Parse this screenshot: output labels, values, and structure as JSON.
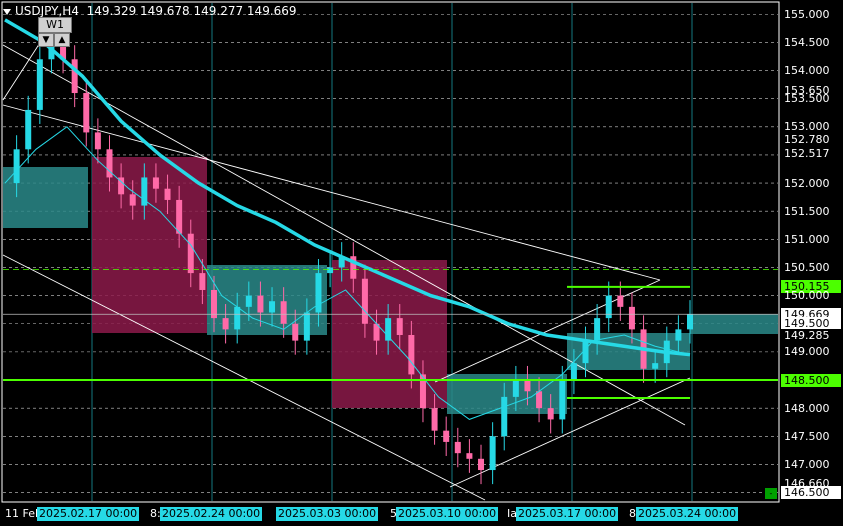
{
  "header": {
    "symbol": "USDJPY,H4",
    "ohlc": "149.329 149.678 149.277 149.669",
    "period_button": "W1"
  },
  "colors": {
    "background": "#000000",
    "grid": "#ffffff",
    "ma_slow": "#26d9e6",
    "ma_fast": "#26d9e6",
    "bull_candle": "#26d9e6",
    "bear_candle": "#ff6aa8",
    "zone_teal": "#2a8a8a",
    "zone_maroon": "#8c1a4a",
    "level_green": "#4cff00",
    "channel": "#ffffff"
  },
  "price_scale": {
    "ticks": [
      "155.000",
      "154.500",
      "154.000",
      "153.650",
      "153.500",
      "153.000",
      "152.780",
      "152.517",
      "152.000",
      "151.500",
      "151.000",
      "150.500",
      "150.155",
      "150.000",
      "149.669",
      "149.500",
      "149.285",
      "149.000",
      "148.500",
      "148.000",
      "147.500",
      "147.000",
      "146.660",
      "146.500"
    ]
  },
  "time_scale": {
    "labels": [
      "11 Feb",
      "2025.02.17 00:00",
      "8:",
      "2025.02.24 00:00",
      "2025.03.03 00:00",
      "5",
      "2025.03.10 00:00",
      "Ia",
      "2025.03.17 00:00",
      "8:",
      "2025.03.24 00:00"
    ]
  },
  "chart_data": {
    "type": "line",
    "instrument": "USDJPY",
    "timeframe": "H4",
    "ylim": [
      146.35,
      155.2
    ],
    "current_price": 149.669,
    "levels": [
      150.155,
      148.5,
      148.18,
      149.5,
      150.5
    ],
    "vertical_dates": [
      "2025.02.17 00:00",
      "2025.02.24 00:00",
      "2025.03.03 00:00",
      "2025.03.10 00:00",
      "2025.03.17 00:00",
      "2025.03.24 00:00"
    ],
    "series": [
      {
        "label": "close",
        "x": [
          0,
          3,
          6,
          9,
          12,
          15,
          18,
          21,
          24,
          27,
          30,
          33,
          36,
          39,
          42,
          45,
          48,
          51,
          54,
          57,
          60,
          63,
          66,
          69,
          72,
          75,
          78,
          81,
          84,
          87,
          90,
          93,
          96,
          99,
          102,
          105,
          108,
          111,
          114,
          117,
          120,
          123,
          126,
          129,
          132,
          135,
          138,
          141,
          144,
          147,
          150,
          153,
          156,
          159,
          162,
          165,
          168,
          171,
          174,
          177
        ],
        "values": [
          152.0,
          152.6,
          153.3,
          154.2,
          154.5,
          154.2,
          153.6,
          152.9,
          152.6,
          152.1,
          151.8,
          151.6,
          152.1,
          151.9,
          151.7,
          151.1,
          150.4,
          150.1,
          149.6,
          149.4,
          149.8,
          150.0,
          149.7,
          149.9,
          149.5,
          149.2,
          149.7,
          150.4,
          150.5,
          150.7,
          150.3,
          149.5,
          149.2,
          149.6,
          149.3,
          148.6,
          148.0,
          147.6,
          147.4,
          147.2,
          147.1,
          146.9,
          147.5,
          148.2,
          148.5,
          148.3,
          148.0,
          147.8,
          148.5,
          148.8,
          149.2,
          149.6,
          150.0,
          149.8,
          149.4,
          148.7,
          148.8,
          149.2,
          149.4,
          149.67
        ]
      },
      {
        "label": "ma_slow",
        "x": [
          0,
          10,
          20,
          30,
          40,
          50,
          60,
          70,
          80,
          90,
          100,
          110,
          120,
          130,
          140,
          150,
          160,
          170,
          177
        ],
        "values": [
          154.9,
          154.5,
          153.9,
          153.1,
          152.5,
          152.0,
          151.6,
          151.3,
          150.9,
          150.6,
          150.3,
          150.0,
          149.8,
          149.5,
          149.3,
          149.2,
          149.1,
          149.0,
          148.95
        ]
      },
      {
        "label": "ma_fast",
        "x": [
          0,
          8,
          16,
          24,
          32,
          40,
          48,
          56,
          64,
          72,
          80,
          88,
          96,
          104,
          112,
          120,
          128,
          136,
          144,
          152,
          160,
          168,
          177
        ],
        "values": [
          152.0,
          152.6,
          153.0,
          152.4,
          151.9,
          151.5,
          150.9,
          150.0,
          149.6,
          149.4,
          149.8,
          150.1,
          149.5,
          148.9,
          148.2,
          147.8,
          148.0,
          148.2,
          148.6,
          149.2,
          149.3,
          149.1,
          148.95
        ]
      }
    ]
  }
}
